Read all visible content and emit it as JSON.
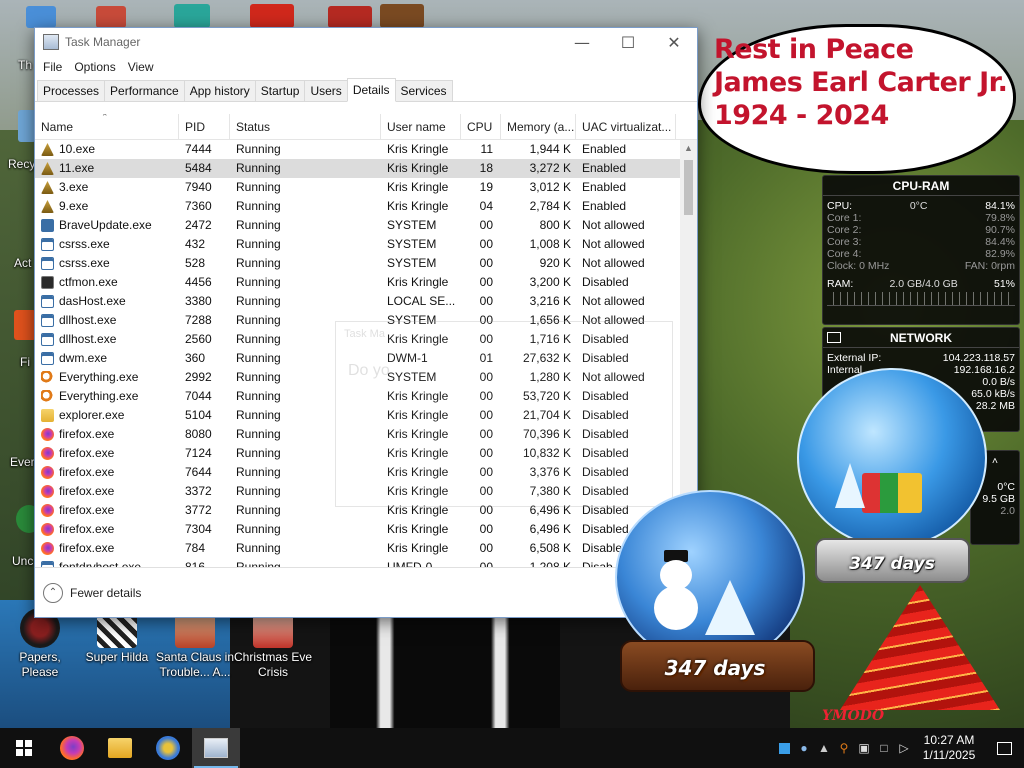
{
  "desktop": {
    "partial_labels": [
      "Th",
      "Recy",
      "Act",
      "Fi",
      "Ever",
      "Unc"
    ],
    "icons": [
      {
        "label": "Papers, Please"
      },
      {
        "label": "Super Hilda"
      },
      {
        "label": "Santa Claus in Trouble... A..."
      },
      {
        "label": "Christmas Eve Crisis"
      }
    ]
  },
  "task_manager": {
    "title": "Task Manager",
    "menu": [
      "File",
      "Options",
      "View"
    ],
    "tabs": [
      "Processes",
      "Performance",
      "App history",
      "Startup",
      "Users",
      "Details",
      "Services"
    ],
    "active_tab": "Details",
    "columns": [
      "Name",
      "PID",
      "Status",
      "User name",
      "CPU",
      "Memory (a...",
      "UAC virtualizat..."
    ],
    "rows": [
      {
        "icon": "exe-warn",
        "name": "10.exe",
        "pid": "7444",
        "status": "Running",
        "user": "Kris Kringle",
        "cpu": "11",
        "mem": "1,944 K",
        "uac": "Enabled"
      },
      {
        "icon": "exe-warn",
        "name": "11.exe",
        "pid": "5484",
        "status": "Running",
        "user": "Kris Kringle",
        "cpu": "18",
        "mem": "3,272 K",
        "uac": "Enabled"
      },
      {
        "icon": "exe-warn",
        "name": "3.exe",
        "pid": "7940",
        "status": "Running",
        "user": "Kris Kringle",
        "cpu": "19",
        "mem": "3,012 K",
        "uac": "Enabled"
      },
      {
        "icon": "exe-warn",
        "name": "9.exe",
        "pid": "7360",
        "status": "Running",
        "user": "Kris Kringle",
        "cpu": "04",
        "mem": "2,784 K",
        "uac": "Enabled"
      },
      {
        "icon": "brave",
        "name": "BraveUpdate.exe",
        "pid": "2472",
        "status": "Running",
        "user": "SYSTEM",
        "cpu": "00",
        "mem": "800 K",
        "uac": "Not allowed"
      },
      {
        "icon": "win",
        "name": "csrss.exe",
        "pid": "432",
        "status": "Running",
        "user": "SYSTEM",
        "cpu": "00",
        "mem": "1,008 K",
        "uac": "Not allowed"
      },
      {
        "icon": "win",
        "name": "csrss.exe",
        "pid": "528",
        "status": "Running",
        "user": "SYSTEM",
        "cpu": "00",
        "mem": "920 K",
        "uac": "Not allowed"
      },
      {
        "icon": "ctf",
        "name": "ctfmon.exe",
        "pid": "4456",
        "status": "Running",
        "user": "Kris Kringle",
        "cpu": "00",
        "mem": "3,200 K",
        "uac": "Disabled"
      },
      {
        "icon": "win",
        "name": "dasHost.exe",
        "pid": "3380",
        "status": "Running",
        "user": "LOCAL SE...",
        "cpu": "00",
        "mem": "3,216 K",
        "uac": "Not allowed"
      },
      {
        "icon": "win",
        "name": "dllhost.exe",
        "pid": "7288",
        "status": "Running",
        "user": "SYSTEM",
        "cpu": "00",
        "mem": "1,656 K",
        "uac": "Not allowed"
      },
      {
        "icon": "win",
        "name": "dllhost.exe",
        "pid": "2560",
        "status": "Running",
        "user": "Kris Kringle",
        "cpu": "00",
        "mem": "1,716 K",
        "uac": "Disabled"
      },
      {
        "icon": "win",
        "name": "dwm.exe",
        "pid": "360",
        "status": "Running",
        "user": "DWM-1",
        "cpu": "01",
        "mem": "27,632 K",
        "uac": "Disabled"
      },
      {
        "icon": "search",
        "name": "Everything.exe",
        "pid": "2992",
        "status": "Running",
        "user": "SYSTEM",
        "cpu": "00",
        "mem": "1,280 K",
        "uac": "Not allowed"
      },
      {
        "icon": "search",
        "name": "Everything.exe",
        "pid": "7044",
        "status": "Running",
        "user": "Kris Kringle",
        "cpu": "00",
        "mem": "53,720 K",
        "uac": "Disabled"
      },
      {
        "icon": "folder",
        "name": "explorer.exe",
        "pid": "5104",
        "status": "Running",
        "user": "Kris Kringle",
        "cpu": "00",
        "mem": "21,704 K",
        "uac": "Disabled"
      },
      {
        "icon": "firefox",
        "name": "firefox.exe",
        "pid": "8080",
        "status": "Running",
        "user": "Kris Kringle",
        "cpu": "00",
        "mem": "70,396 K",
        "uac": "Disabled"
      },
      {
        "icon": "firefox",
        "name": "firefox.exe",
        "pid": "7124",
        "status": "Running",
        "user": "Kris Kringle",
        "cpu": "00",
        "mem": "10,832 K",
        "uac": "Disabled"
      },
      {
        "icon": "firefox",
        "name": "firefox.exe",
        "pid": "7644",
        "status": "Running",
        "user": "Kris Kringle",
        "cpu": "00",
        "mem": "3,376 K",
        "uac": "Disabled"
      },
      {
        "icon": "firefox",
        "name": "firefox.exe",
        "pid": "3372",
        "status": "Running",
        "user": "Kris Kringle",
        "cpu": "00",
        "mem": "7,380 K",
        "uac": "Disabled"
      },
      {
        "icon": "firefox",
        "name": "firefox.exe",
        "pid": "3772",
        "status": "Running",
        "user": "Kris Kringle",
        "cpu": "00",
        "mem": "6,496 K",
        "uac": "Disabled"
      },
      {
        "icon": "firefox",
        "name": "firefox.exe",
        "pid": "7304",
        "status": "Running",
        "user": "Kris Kringle",
        "cpu": "00",
        "mem": "6,496 K",
        "uac": "Disabled"
      },
      {
        "icon": "firefox",
        "name": "firefox.exe",
        "pid": "784",
        "status": "Running",
        "user": "Kris Kringle",
        "cpu": "00",
        "mem": "6,508 K",
        "uac": "Disable"
      },
      {
        "icon": "win",
        "name": "fontdrvhost.exe",
        "pid": "816",
        "status": "Running",
        "user": "UMFD-0",
        "cpu": "00",
        "mem": "1,208 K",
        "uac": "Disab"
      }
    ],
    "selected_row": 1,
    "ghost_dialog": {
      "title": "Task Ma",
      "question": "Do yo"
    },
    "footer": {
      "fewer_details": "Fewer details"
    }
  },
  "bubble": {
    "lines": [
      "Rest in Peace",
      "James Earl Carter Jr.",
      "1924 - 2024"
    ]
  },
  "cpu_gadget": {
    "title": "CPU-RAM",
    "cpu": {
      "label": "CPU:",
      "temp": "0°C",
      "value": "84.1%"
    },
    "cores": [
      {
        "label": "Core 1:",
        "value": "79.8%"
      },
      {
        "label": "Core 2:",
        "value": "90.7%"
      },
      {
        "label": "Core 3:",
        "value": "84.4%"
      },
      {
        "label": "Core 4:",
        "value": "82.9%"
      }
    ],
    "clock": "Clock: 0 MHz",
    "fan": "FAN: 0rpm",
    "ram": {
      "label": "RAM:",
      "usage": "2.0 GB/4.0 GB",
      "value": "51%"
    }
  },
  "network_gadget": {
    "title": "NETWORK",
    "rows": [
      {
        "label": "External IP:",
        "value": "104.223.118.57"
      },
      {
        "label": "Internal",
        "value": "192.168.16.2"
      },
      {
        "label": "",
        "value": "0.0 B/s"
      },
      {
        "label": "",
        "value": "65.0 kB/s"
      },
      {
        "label": "",
        "value": "28.2 MB"
      }
    ]
  },
  "drive_gadget": {
    "temp": "0°C",
    "size": "9.5 GB",
    "extra": "2.0"
  },
  "globes": {
    "big_days": "347 days",
    "small_days": "347 days"
  },
  "taskbar": {
    "clock_time": "10:27 AM",
    "clock_date": "1/11/2025"
  }
}
